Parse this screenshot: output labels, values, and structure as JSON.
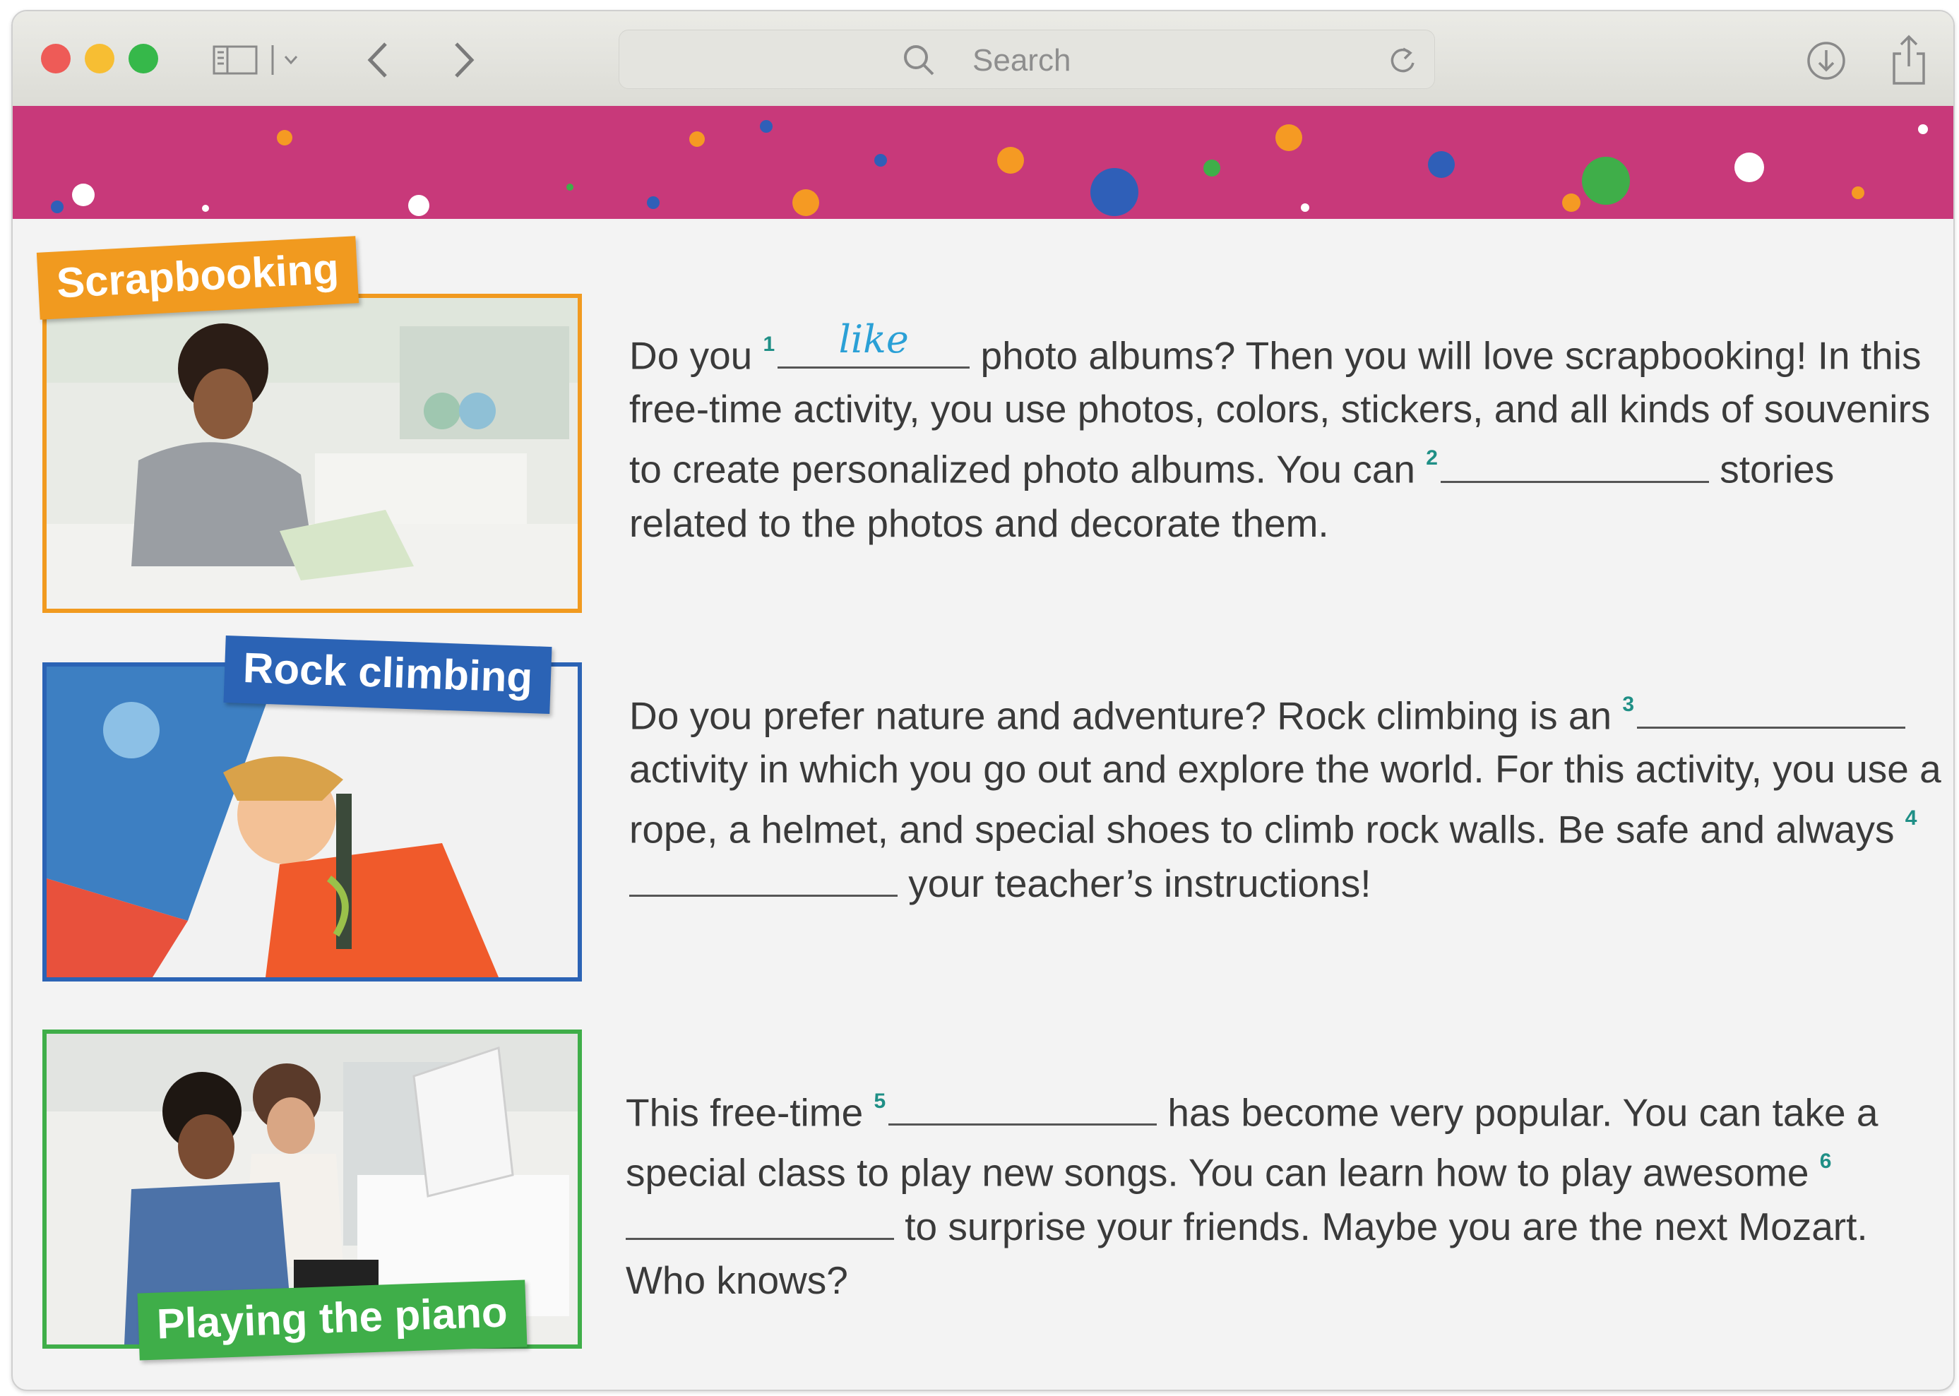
{
  "browser": {
    "search_placeholder": "Search",
    "traffic_lights": [
      "#ee5b57",
      "#f7be33",
      "#36b84a"
    ]
  },
  "activities": [
    {
      "label": "Scrapbooking",
      "label_color": "#f19a1f",
      "paragraph": [
        {
          "t": "Do you "
        },
        {
          "n": "1",
          "answer": "like"
        },
        {
          "t": " photo albums? Then you will love scrapbooking! In this free-time activity, you use photos, colors, stickers, and all kinds of souvenirs to create personalized photo albums. You can "
        },
        {
          "n": "2",
          "answer": ""
        },
        {
          "t": " stories related to the photos and decorate them."
        }
      ]
    },
    {
      "label": "Rock climbing",
      "label_color": "#2b63b5",
      "paragraph": [
        {
          "t": "Do you prefer nature and adventure? Rock climbing is an "
        },
        {
          "n": "3",
          "answer": ""
        },
        {
          "t": " activity in which you go out and explore the world. For this activity, you use a rope, a helmet, and special shoes to climb rock walls. Be safe and always "
        },
        {
          "n": "4",
          "answer": ""
        },
        {
          "t": " your teacher’s instructions!"
        }
      ]
    },
    {
      "label": "Playing the piano",
      "label_color": "#3fae49",
      "paragraph": [
        {
          "t": "This free-time "
        },
        {
          "n": "5",
          "answer": ""
        },
        {
          "t": " has become very popular. You can take a special class to play new songs. You can learn how to play awesome "
        },
        {
          "n": "6",
          "answer": ""
        },
        {
          "t": " to surprise your friends. Maybe you are the next Mozart. Who knows?"
        }
      ]
    }
  ]
}
